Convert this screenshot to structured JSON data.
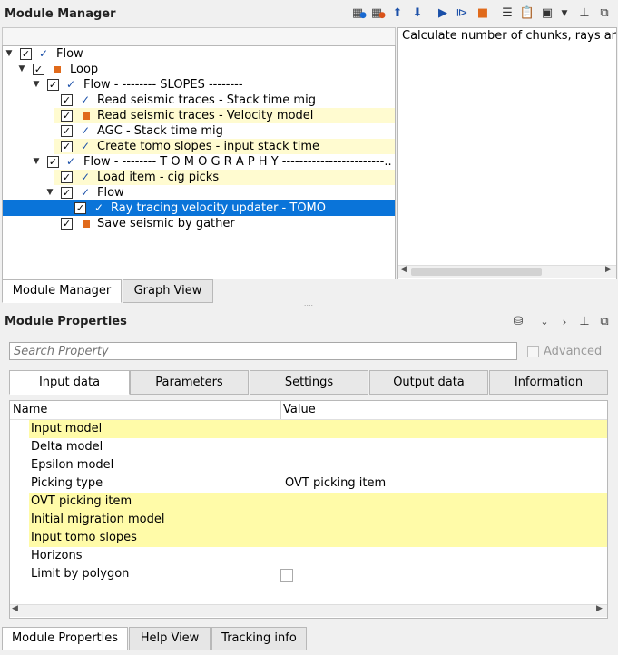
{
  "module_manager": {
    "title": "Module Manager",
    "tree": [
      {
        "label": "Flow",
        "marker": "tick",
        "expanded": true,
        "checked": true,
        "highlight": false,
        "selected": false
      },
      {
        "label": "Loop",
        "marker": "square",
        "expanded": true,
        "checked": true,
        "highlight": false,
        "selected": false
      },
      {
        "label": "Flow - -------- SLOPES --------",
        "marker": "tick",
        "expanded": true,
        "checked": true,
        "highlight": false,
        "selected": false
      },
      {
        "label": "Read seismic traces - Stack time mig",
        "marker": "tick",
        "checked": true,
        "highlight": false,
        "selected": false
      },
      {
        "label": "Read seismic traces - Velocity model",
        "marker": "square",
        "checked": true,
        "highlight": true,
        "selected": false
      },
      {
        "label": "AGC - Stack time mig",
        "marker": "tick",
        "checked": true,
        "highlight": false,
        "selected": false
      },
      {
        "label": "Create tomo slopes - input stack time",
        "marker": "tick",
        "checked": true,
        "highlight": true,
        "selected": false
      },
      {
        "label": "Flow - -------- T O M O G R A P H Y ------------------------...",
        "marker": "tick",
        "expanded": true,
        "checked": true,
        "highlight": false,
        "selected": false
      },
      {
        "label": "Load item - cig picks",
        "marker": "tick",
        "checked": true,
        "highlight": true,
        "selected": false
      },
      {
        "label": "Flow",
        "marker": "tick",
        "expanded": true,
        "checked": true,
        "highlight": false,
        "selected": false
      },
      {
        "label": "Ray tracing velocity updater - TOMO",
        "marker": "tick",
        "checked": true,
        "highlight": false,
        "selected": true
      },
      {
        "label": "Save seismic by gather",
        "marker": "square",
        "checked": true,
        "highlight": false,
        "selected": false
      }
    ],
    "description": "Calculate number of chunks, rays ar",
    "tabs": [
      "Module Manager",
      "Graph View"
    ]
  },
  "module_properties": {
    "title": "Module Properties",
    "search_placeholder": "Search Property",
    "advanced_label": "Advanced",
    "tabs": [
      "Input data",
      "Parameters",
      "Settings",
      "Output data",
      "Information"
    ],
    "columns": {
      "name": "Name",
      "value": "Value"
    },
    "rows": [
      {
        "name": "Input model",
        "value": "",
        "highlight": true
      },
      {
        "name": "Delta model",
        "value": "",
        "highlight": false
      },
      {
        "name": "Epsilon model",
        "value": "",
        "highlight": false
      },
      {
        "name": "Picking type",
        "value": "OVT picking item",
        "highlight": false
      },
      {
        "name": "OVT picking item",
        "value": "",
        "highlight": true
      },
      {
        "name": "Initial migration model",
        "value": "",
        "highlight": true
      },
      {
        "name": "Input tomo slopes",
        "value": "",
        "highlight": true
      },
      {
        "name": "Horizons",
        "value": "",
        "highlight": false
      },
      {
        "name": "Limit by polygon",
        "value": "",
        "checkbox": true,
        "highlight": false
      }
    ],
    "bottom_tabs": [
      "Module Properties",
      "Help View",
      "Tracking info"
    ]
  },
  "colors": {
    "selection": "#0a74d9",
    "highlight": "#fffba8",
    "marker_orange": "#e06a1b",
    "tick_blue": "#1a4fa8"
  }
}
